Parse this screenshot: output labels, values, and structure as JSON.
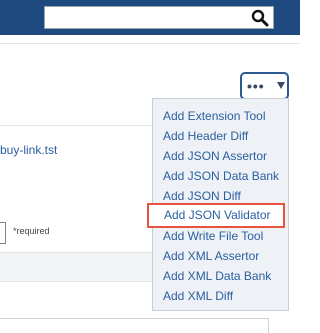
{
  "header": {
    "search": {
      "value": "",
      "placeholder": ""
    }
  },
  "toolbar": {
    "more_label": "•••"
  },
  "content": {
    "file_link": "buy-link.tst",
    "required_note": "*required"
  },
  "dropdown": {
    "items": [
      "Add Extension Tool",
      "Add Header Diff",
      "Add JSON Assertor",
      "Add JSON Data Bank",
      "Add JSON Diff",
      "Add JSON Validator",
      "Add Write File Tool",
      "Add XML Assertor",
      "Add XML Data Bank",
      "Add XML Diff"
    ],
    "highlighted_index": 5
  },
  "colors": {
    "header_bg": "#1f4a80",
    "link": "#2a5fa0",
    "highlight_border": "#e8533e"
  }
}
